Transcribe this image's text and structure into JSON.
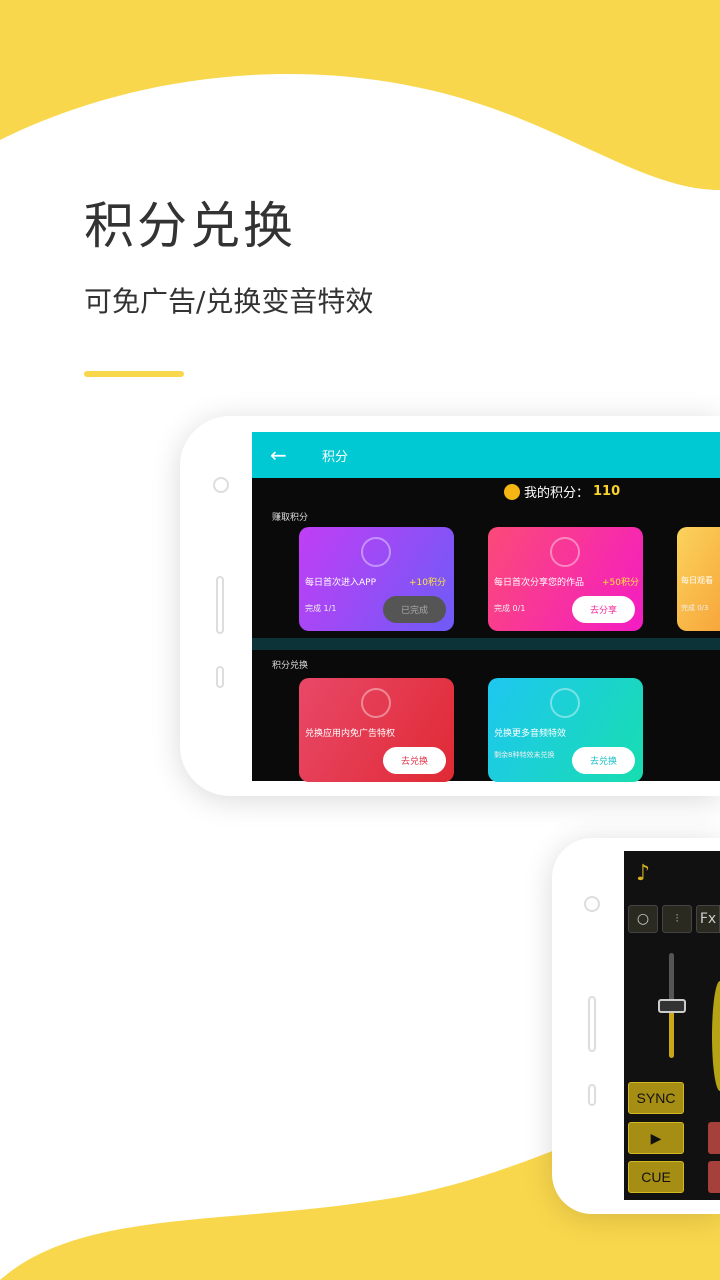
{
  "colors": {
    "accent": "#F9D74C",
    "header": "#00C9D4"
  },
  "hero": {
    "title": "积分兑换",
    "subtitle": "可免广告/兑换变音特效"
  },
  "app": {
    "header": {
      "back_icon": "arrow-left",
      "title": "积分"
    },
    "my_points": {
      "label": "我的积分：",
      "value": "110"
    },
    "earn": {
      "section": "赚取积分",
      "cards": [
        {
          "title": "每日首次进入APP",
          "reward": "+10积分",
          "progress": "完成 1/1",
          "button": "已完成"
        },
        {
          "title": "每日首次分享您的作品",
          "reward": "+50积分",
          "progress": "完成 0/1",
          "button": "去分享"
        },
        {
          "title": "每日观看",
          "progress": "完成 0/3"
        }
      ]
    },
    "exchange": {
      "section": "积分兑换",
      "cards": [
        {
          "title": "兑换应用内免广告特权",
          "button": "去兑换"
        },
        {
          "title": "兑换更多音频特效",
          "note": "剩余8种特效未兑换",
          "button": "去兑换"
        }
      ]
    }
  },
  "dj": {
    "music_icon": "music-note-plus",
    "tools": [
      "sync-loop-icon",
      "mixer-icon",
      "Fx"
    ],
    "sync": "SYNC",
    "play": "▶",
    "cue": "CUE"
  }
}
